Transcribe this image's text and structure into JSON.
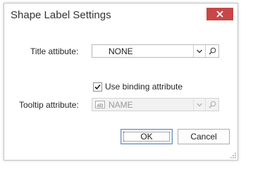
{
  "dialog": {
    "title": "Shape Label Settings",
    "close_icon": "close-icon"
  },
  "title_attribute": {
    "label": "Title attibute:",
    "value": "NONE"
  },
  "use_binding": {
    "label": "Use binding attribute",
    "checked": true
  },
  "tooltip_attribute": {
    "label": "Tooltip attribute:",
    "value": "NAME",
    "icon": "ab-icon",
    "enabled": false
  },
  "buttons": {
    "ok": "OK",
    "cancel": "Cancel"
  },
  "colors": {
    "close_bg": "#c74747",
    "default_button_border": "#6a8fc1"
  }
}
